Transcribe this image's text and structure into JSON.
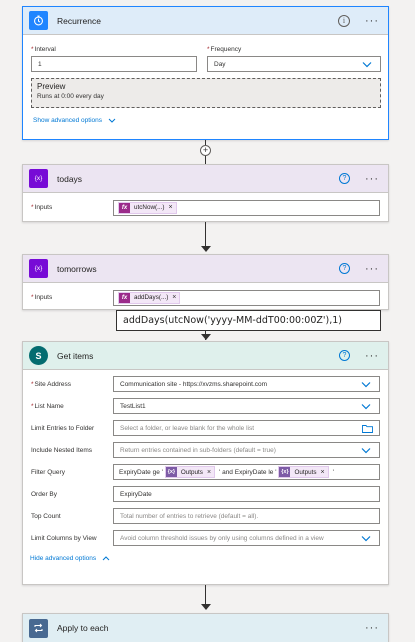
{
  "recurrence": {
    "title": "Recurrence",
    "interval_label": "Interval",
    "interval_value": "1",
    "frequency_label": "Frequency",
    "frequency_value": "Day",
    "preview_title": "Preview",
    "preview_text": "Runs at 0:00 every day",
    "advanced_link": "Show advanced options",
    "info_icon": "i",
    "more_icon": "···"
  },
  "todays": {
    "title": "todays",
    "inputs_label": "Inputs",
    "token": "utcNow(...)",
    "token_icon": "fx",
    "help_icon": "?",
    "more_icon": "···"
  },
  "tomorrows": {
    "title": "tomorrows",
    "inputs_label": "Inputs",
    "token": "addDays(...)",
    "token_icon": "fx",
    "help_icon": "?",
    "more_icon": "···"
  },
  "tooltip_text": "addDays(utcNow('yyyy-MM-ddT00:00:00Z'),1)",
  "get_items": {
    "title": "Get items",
    "help_icon": "?",
    "more_icon": "···",
    "site_label": "Site Address",
    "site_value": "Communication site - https://xvzms.sharepoint.com",
    "list_label": "List Name",
    "list_value": "TestList1",
    "limit_folder_label": "Limit Entries to Folder",
    "limit_folder_placeholder": "Select a folder, or leave blank for the whole list",
    "nested_label": "Include Nested Items",
    "nested_value": "Return entries contained in sub-folders (default = true)",
    "filter_label": "Filter Query",
    "filter_prefix": "ExpiryDate ge '",
    "filter_token1": "Outputs",
    "filter_mid": "' and ExpiryDate le '",
    "filter_token2": "Outputs",
    "filter_suffix": "'",
    "orderby_label": "Order By",
    "orderby_value": "ExpiryDate",
    "topcount_label": "Top Count",
    "topcount_placeholder": "Total number of entries to retrieve (default = all).",
    "limitcols_label": "Limit Columns by View",
    "limitcols_placeholder": "Avoid column threshold issues by only using columns defined in a view",
    "hide_link": "Hide advanced options"
  },
  "apply": {
    "title": "Apply to each",
    "more_icon": "···"
  },
  "colors": {
    "recurrence_accent": "#1f85ff",
    "variable_accent": "#770bd6",
    "sharepoint_accent": "#036c70",
    "control_accent": "#486991"
  }
}
